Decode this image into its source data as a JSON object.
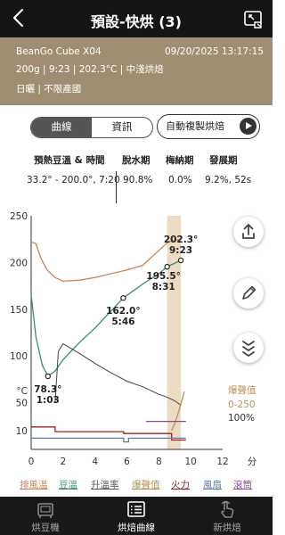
{
  "header": {
    "title": "預設-快烘 (3)"
  },
  "info": {
    "device": "BeanGo Cube X04",
    "datetime": "09/20/2025 13:17:15",
    "line2": "200g  |  9:23  |  202.3°C  |  中淺烘焙",
    "line3": "日曬  |  不限產國"
  },
  "tabs": [
    {
      "label": "曲線",
      "active": true
    },
    {
      "label": "資訊",
      "active": false
    }
  ],
  "copy_button": {
    "label": "自動複製烘焙"
  },
  "phases": {
    "headers": [
      "預熱豆溫 & 時間",
      "脫水期",
      "梅納期",
      "發展期"
    ],
    "values": [
      "33.2° - 200.0°, 7:20",
      "90.8%",
      "0.0%",
      "9.2%, 52s"
    ]
  },
  "chart_data": {
    "type": "line",
    "x_unit": "分",
    "xlim": [
      0,
      12
    ],
    "ylim": [
      0,
      250
    ],
    "x_ticks": [
      "0",
      "2",
      "4",
      "6",
      "8",
      "10",
      "12"
    ],
    "y_ticks": [
      "250",
      "200",
      "150",
      "100",
      "50",
      "10",
      "°C"
    ],
    "right_labels": [
      "爆聲值",
      "0-250",
      "100%"
    ],
    "series": [
      {
        "name": "排風溫",
        "color": "#c8855a",
        "x": [
          0,
          0.3,
          0.6,
          1,
          1.5,
          2,
          3,
          4,
          5,
          6,
          7,
          8,
          8.6,
          9.4
        ],
        "y": [
          222,
          220,
          205,
          192,
          184,
          180,
          181,
          184,
          188,
          192,
          197,
          213,
          222,
          225
        ]
      },
      {
        "name": "豆溫",
        "color": "#3a8f6a",
        "x": [
          0,
          0.3,
          0.7,
          1.05,
          1.5,
          2,
          3,
          4,
          5,
          5.77,
          6.5,
          7,
          8,
          8.52,
          9.38
        ],
        "y": [
          165,
          120,
          90,
          78.3,
          84,
          96,
          114,
          130,
          148,
          162.0,
          171,
          177,
          188,
          195.5,
          202.3
        ]
      },
      {
        "name": "升溫率",
        "color": "#444444",
        "x": [
          1.5,
          1.7,
          2,
          2.5,
          3,
          4,
          5,
          6,
          7,
          8,
          8.5,
          9,
          9.4
        ],
        "y": [
          50,
          105,
          113,
          108,
          103,
          92,
          82,
          73,
          67,
          59,
          56,
          52,
          47
        ]
      },
      {
        "name": "爆聲值",
        "color": "#b8915a",
        "x": [
          8.8,
          9,
          9.2,
          9.4,
          9.6
        ],
        "y": [
          20,
          28,
          38,
          50,
          62
        ]
      },
      {
        "name": "火力",
        "color": "#a02020",
        "x": [
          0,
          1.5,
          1.5,
          5.8,
          5.8,
          8.8,
          8.8,
          9.7
        ],
        "y": [
          24,
          24,
          19,
          19,
          17,
          17,
          10,
          10
        ]
      },
      {
        "name": "風扇",
        "color": "#5b7fa8",
        "x": [
          0,
          5.8,
          5.8,
          6.1,
          6.1,
          9.7
        ],
        "y": [
          12,
          12,
          8,
          8,
          12,
          12
        ]
      },
      {
        "name": "滾筒",
        "color": "#8a4a9a",
        "x": [
          7.2,
          9.7
        ],
        "y": [
          30,
          30
        ]
      }
    ],
    "development_band": {
      "x_start": 8.52,
      "x_end": 9.38
    },
    "annotations": [
      {
        "x": 1.05,
        "y": 78.3,
        "label1": "78.3°",
        "label2": "1:03"
      },
      {
        "x": 5.77,
        "y": 162.0,
        "label1": "162.0°",
        "label2": "5:46"
      },
      {
        "x": 8.52,
        "y": 195.5,
        "label1": "195.5°",
        "label2": "8:31"
      },
      {
        "x": 9.38,
        "y": 202.3,
        "label1": "202.3°",
        "label2": "9:23"
      }
    ]
  },
  "legend": [
    "排風溫",
    "豆溫",
    "升溫率",
    "爆聲值",
    "火力",
    "風扇",
    "滾筒"
  ],
  "nav": [
    {
      "label": "烘豆機",
      "active": false
    },
    {
      "label": "烘焙曲線",
      "active": true
    },
    {
      "label": "新烘焙",
      "active": false
    }
  ],
  "side_buttons": [
    "share-icon",
    "edit-icon",
    "collapse-icon"
  ]
}
